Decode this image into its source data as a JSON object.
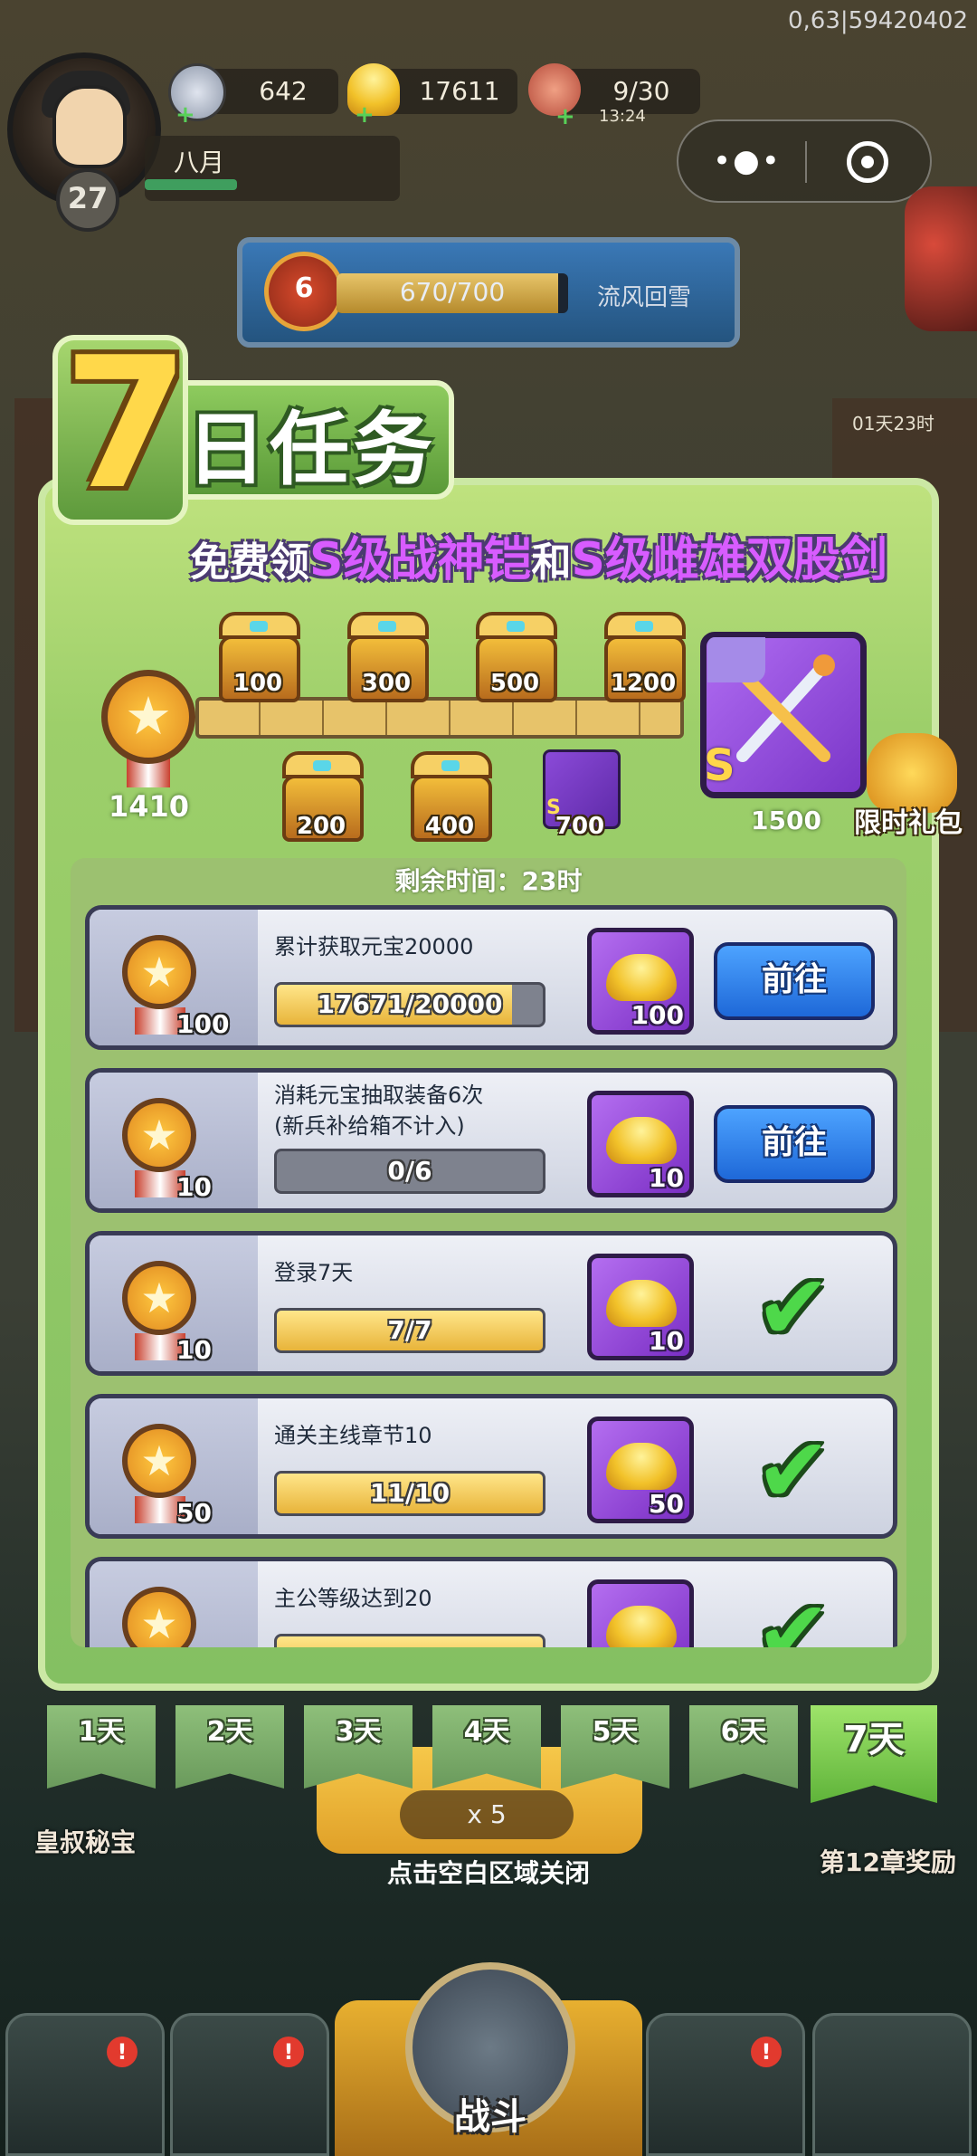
{
  "debug_info": "0,63|59420402",
  "player": {
    "level": "27",
    "name": "八月"
  },
  "resources": [
    {
      "icon": "silver-coin-icon",
      "value": "642"
    },
    {
      "icon": "gold-ingot-icon",
      "value": "17611"
    },
    {
      "icon": "meat-stamina-icon",
      "value": "9/30"
    }
  ],
  "stamina_timer": "13:24",
  "stage": {
    "level": "6",
    "progress_text": "670/700",
    "progress": 0.957,
    "name": "流风回雪"
  },
  "side_countdown": "01天23时",
  "modal": {
    "title_number": "7",
    "title_text": "日任务",
    "subtitle_pre": "免费领",
    "subtitle_item1": "S级战神铠",
    "subtitle_mid": "和",
    "subtitle_item2": "S级雌雄双股剑",
    "total_points": "1410",
    "milestones_top": [
      "100",
      "300",
      "500",
      "1200"
    ],
    "milestones_bottom": [
      "200",
      "400",
      "700"
    ],
    "armor_grade": "S",
    "final_reward_grade": "S",
    "final_reward_points": "1500",
    "gift_label": "限时礼包",
    "remaining_time": "剩余时间：23时",
    "tasks": [
      {
        "points": "100",
        "title": "累计获取元宝20000",
        "progress_text": "17671/20000",
        "progress": 0.884,
        "reward_qty": "100",
        "action": "前往",
        "done": false
      },
      {
        "points": "10",
        "title": "消耗元宝抽取装备6次\n(新兵补给箱不计入)",
        "progress_text": "0/6",
        "progress": 0.0,
        "reward_qty": "10",
        "action": "前往",
        "done": false
      },
      {
        "points": "10",
        "title": "登录7天",
        "progress_text": "7/7",
        "progress": 1.0,
        "reward_qty": "10",
        "action": "",
        "done": true
      },
      {
        "points": "50",
        "title": "通关主线章节10",
        "progress_text": "11/10",
        "progress": 1.0,
        "reward_qty": "50",
        "action": "",
        "done": true
      },
      {
        "points": "",
        "title": "主公等级达到20",
        "progress_text": "",
        "progress": 1.0,
        "reward_qty": "",
        "action": "",
        "done": true
      }
    ],
    "day_tabs": [
      "1天",
      "2天",
      "3天",
      "4天",
      "5天",
      "6天",
      "7天"
    ],
    "active_day": 6
  },
  "behind": {
    "left_label": "皇叔秘宝",
    "right_label": "第12章奖励",
    "food_cost": "x 5",
    "close_hint": "点击空白区域关闭",
    "battle_label": "战斗",
    "badge": "!"
  },
  "colors": {
    "panel_green": "#9dcf6a",
    "go_button_blue": "#1e68d8",
    "reward_purple": "#7a2ec4",
    "check_green": "#4ed84a"
  }
}
